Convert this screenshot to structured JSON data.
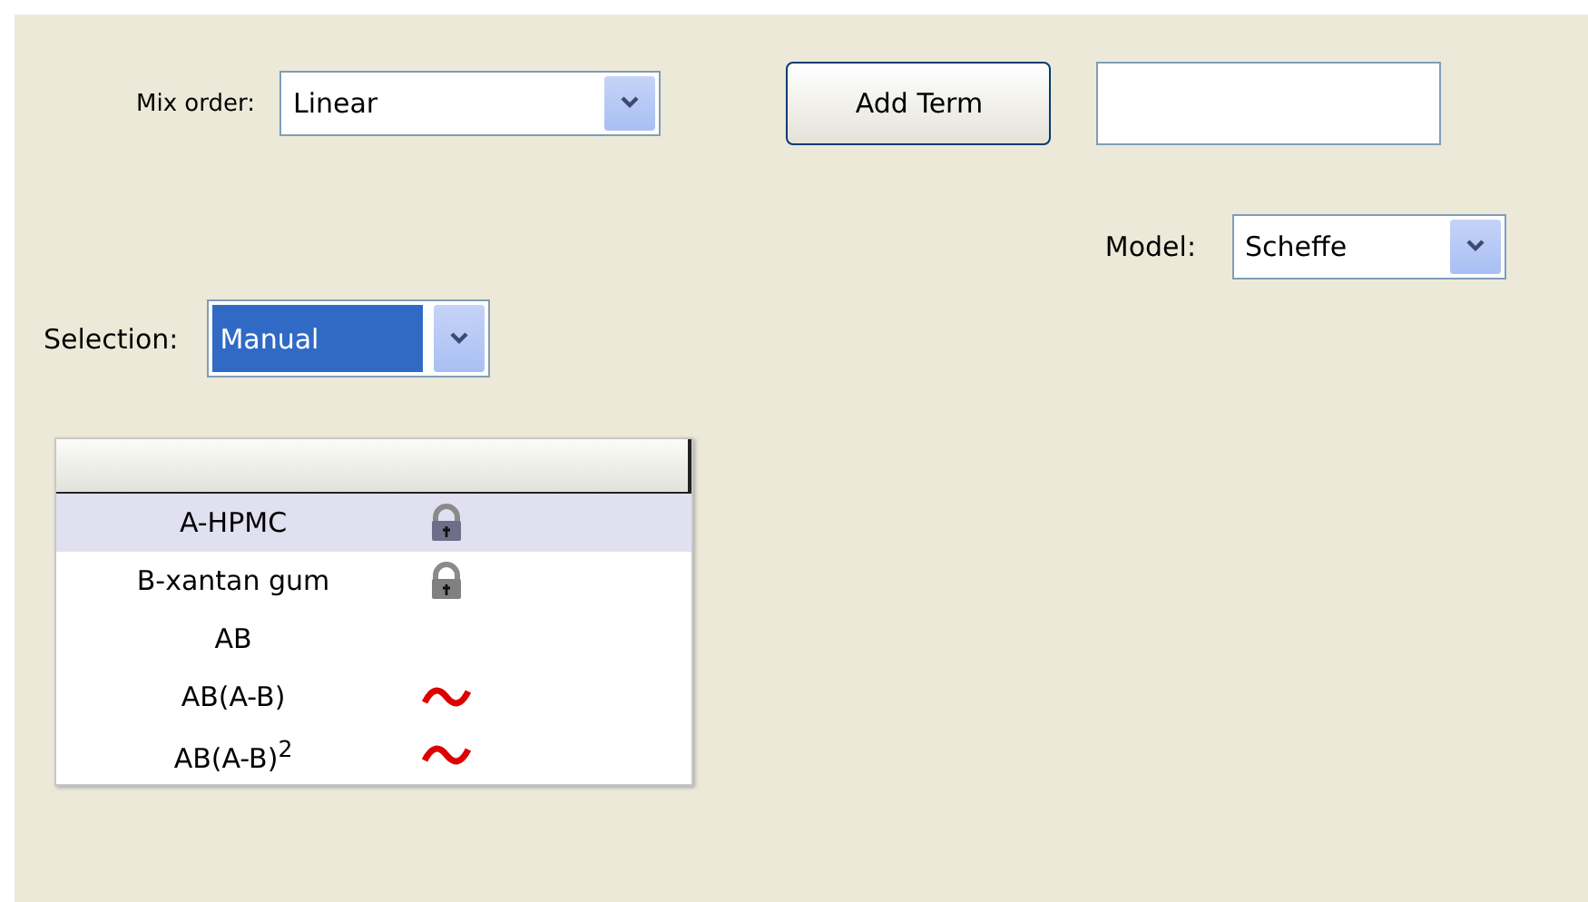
{
  "mix_order": {
    "label": "Mix order:",
    "value": "Linear"
  },
  "add_term": {
    "button": "Add Term"
  },
  "model": {
    "label": "Model:",
    "value": "Scheffe"
  },
  "selection": {
    "label": "Selection:",
    "value": "Manual",
    "highlighted": true
  },
  "terms_table": {
    "rows": [
      {
        "term": "A-HPMC",
        "kind": "locked",
        "selected": true
      },
      {
        "term": "B-xantan gum",
        "kind": "locked",
        "selected": false
      },
      {
        "term": "AB",
        "kind": "plain",
        "selected": false
      },
      {
        "term": "AB(A-B)",
        "kind": "wavy",
        "selected": false
      },
      {
        "term": "AB(A-B)$^{2}$",
        "kind": "wavy",
        "selected": false
      }
    ]
  }
}
